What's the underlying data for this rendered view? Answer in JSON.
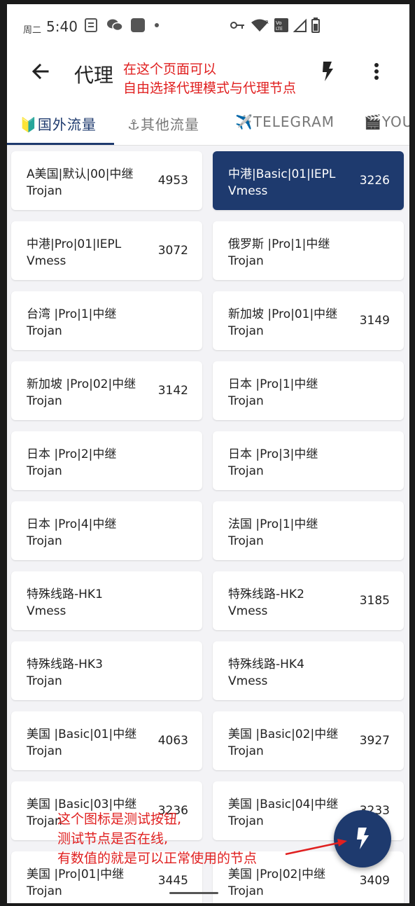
{
  "status": {
    "weekday": "周二",
    "time": "5:40",
    "left_icons": [
      "notes-icon",
      "wechat-icon",
      "square-app-icon",
      "dot-icon"
    ],
    "right_icons": [
      "key-icon",
      "wifi-icon",
      "volte-icon",
      "signal-icon",
      "battery-icon"
    ]
  },
  "appbar": {
    "title": "代理",
    "back_icon": "arrow-left-icon",
    "test_icon": "lightning-icon",
    "menu_icon": "more-vertical-icon"
  },
  "annotations": {
    "top_line1": "在这个页面可以",
    "top_line2": "自由选择代理模式与代理节点",
    "bottom_line1": "这个图标是测试按钮,",
    "bottom_line2": "测试节点是否在线,",
    "bottom_line3": "有数值的就是可以正常使用的节点",
    "color": "#e02020"
  },
  "tabs": [
    {
      "icon": "🔰",
      "label": "国外流量"
    },
    {
      "icon": "⚓",
      "label": "其他流量"
    },
    {
      "icon": "✈️",
      "label": "TELEGRAM"
    },
    {
      "icon": "🎬",
      "label": "YOUTUBE"
    }
  ],
  "nodes": [
    {
      "name": "A美国|默认|00|中继",
      "protocol": "Trojan",
      "latency": "4953",
      "selected": false
    },
    {
      "name": "中港|Basic|01|IEPL",
      "protocol": "Vmess",
      "latency": "3226",
      "selected": true
    },
    {
      "name": "中港|Pro|01|IEPL",
      "protocol": "Vmess",
      "latency": "3072",
      "selected": false
    },
    {
      "name": "俄罗斯 |Pro|1|中继",
      "protocol": "Trojan",
      "latency": "",
      "selected": false
    },
    {
      "name": "台湾 |Pro|1|中继",
      "protocol": "Trojan",
      "latency": "",
      "selected": false
    },
    {
      "name": "新加坡 |Pro|01|中继",
      "protocol": "Trojan",
      "latency": "3149",
      "selected": false
    },
    {
      "name": "新加坡 |Pro|02|中继",
      "protocol": "Trojan",
      "latency": "3142",
      "selected": false
    },
    {
      "name": "日本 |Pro|1|中继",
      "protocol": "Trojan",
      "latency": "",
      "selected": false
    },
    {
      "name": "日本 |Pro|2|中继",
      "protocol": "Trojan",
      "latency": "",
      "selected": false
    },
    {
      "name": "日本 |Pro|3|中继",
      "protocol": "Trojan",
      "latency": "",
      "selected": false
    },
    {
      "name": "日本 |Pro|4|中继",
      "protocol": "Trojan",
      "latency": "",
      "selected": false
    },
    {
      "name": "法国 |Pro|1|中继",
      "protocol": "Trojan",
      "latency": "",
      "selected": false
    },
    {
      "name": "特殊线路-HK1",
      "protocol": "Vmess",
      "latency": "",
      "selected": false
    },
    {
      "name": "特殊线路-HK2",
      "protocol": "Vmess",
      "latency": "3185",
      "selected": false
    },
    {
      "name": "特殊线路-HK3",
      "protocol": "Trojan",
      "latency": "",
      "selected": false
    },
    {
      "name": "特殊线路-HK4",
      "protocol": "Vmess",
      "latency": "",
      "selected": false
    },
    {
      "name": "美国 |Basic|01|中继",
      "protocol": "Trojan",
      "latency": "4063",
      "selected": false
    },
    {
      "name": "美国 |Basic|02|中继",
      "protocol": "Trojan",
      "latency": "3927",
      "selected": false
    },
    {
      "name": "美国 |Basic|03|中继",
      "protocol": "Trojan",
      "latency": "3236",
      "selected": false
    },
    {
      "name": "美国 |Basic|04|中继",
      "protocol": "Trojan",
      "latency": "3233",
      "selected": false
    },
    {
      "name": "美国 |Pro|01|中继",
      "protocol": "Trojan",
      "latency": "3445",
      "selected": false
    },
    {
      "name": "美国 |Pro|02|中继",
      "protocol": "Trojan",
      "latency": "3409",
      "selected": false
    }
  ],
  "fab": {
    "icon": "lightning-icon"
  },
  "colors": {
    "accent": "#1e3a6e",
    "background": "#f3f3f6"
  }
}
